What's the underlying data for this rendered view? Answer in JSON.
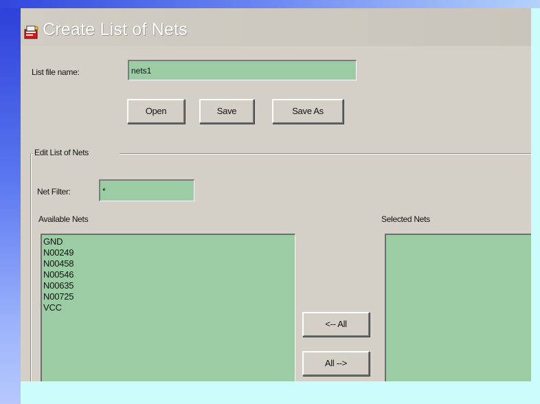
{
  "window": {
    "title": "Create List of Nets"
  },
  "file": {
    "label": "List file name:",
    "value": "nets1"
  },
  "buttons": {
    "open": "Open",
    "save": "Save",
    "save_as": "Save As"
  },
  "group": {
    "title": "Edit List of Nets"
  },
  "filter": {
    "label": "Net Filter:",
    "value": "*"
  },
  "available": {
    "label": "Available Nets",
    "items": [
      "GND",
      "N00249",
      "N00458",
      "N00546",
      "N00635",
      "N00725",
      "VCC"
    ]
  },
  "selected": {
    "label": "Selected Nets",
    "items": []
  },
  "transfer": {
    "remove_all": "<-- All",
    "add_all": "All -->"
  },
  "colors": {
    "field_bg": "#9ccca4",
    "window_bg": "#d4d0c8",
    "page_bg": "#ccfcfc",
    "accent_blue": "#2a3fd8"
  },
  "icons": {
    "title": "app-icon"
  }
}
